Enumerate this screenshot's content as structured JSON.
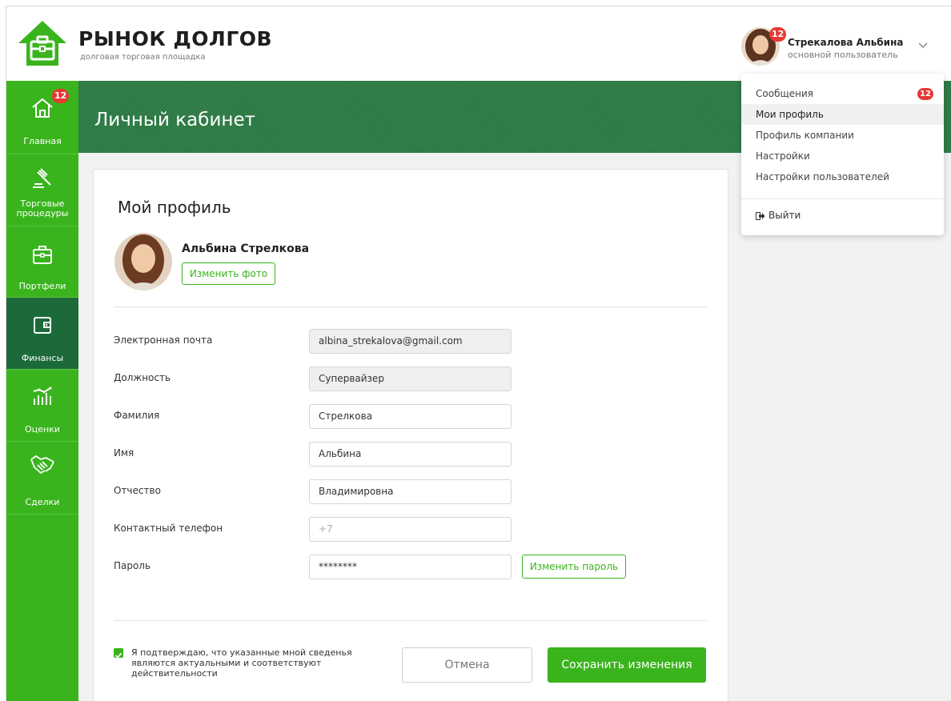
{
  "header": {
    "title": "РЫНОК ДОЛГОВ",
    "subtitle": "долговая торговая площадка",
    "user": {
      "name": "Стрекалова Альбина",
      "role": "основной пользователь",
      "badge": "12"
    }
  },
  "sidebar": {
    "items": [
      {
        "label": "Главная",
        "icon": "home-icon",
        "badge": "12"
      },
      {
        "label": "Торговые процедуры",
        "icon": "gavel-icon"
      },
      {
        "label": "Портфели",
        "icon": "briefcase-icon"
      },
      {
        "label": "Финансы",
        "icon": "wallet-icon",
        "active": true
      },
      {
        "label": "Оценки",
        "icon": "chart-icon"
      },
      {
        "label": "Сделки",
        "icon": "handshake-icon"
      }
    ]
  },
  "banner": {
    "title": "Личный кабинет"
  },
  "profile": {
    "title": "Мой профиль",
    "full_name": "Альбина Стрелкова",
    "change_photo": "Изменить фото",
    "fields": [
      {
        "label": "Электронная почта",
        "value": "albina_strekalova@gmail.com",
        "readonly": true
      },
      {
        "label": "Должность",
        "value": "Супервайзер",
        "readonly": true
      },
      {
        "label": "Фамилия",
        "value": "Стрелкова"
      },
      {
        "label": "Имя",
        "value": "Альбина"
      },
      {
        "label": "Отчество",
        "value": "Владимировна"
      },
      {
        "label": "Контактный телефон",
        "value": "",
        "placeholder": "+7"
      },
      {
        "label": "Пароль",
        "value": "********"
      }
    ],
    "change_password": "Изменить пароль",
    "confirm_text": "Я подтверждаю, что указанные мной сведенья являются актуальными и соответствуют действительности",
    "confirm_checked": true,
    "cancel": "Отмена",
    "save": "Сохранить изменения"
  },
  "dropdown": {
    "items": [
      {
        "label": "Сообщения",
        "badge": "12"
      },
      {
        "label": "Мои профиль",
        "hover": true
      },
      {
        "label": "Профиль компании"
      },
      {
        "label": "Настройки"
      },
      {
        "label": "Настройки пользователей"
      }
    ],
    "logout": "Выйти"
  },
  "colors": {
    "brand_green": "#3ab41d",
    "dark_green": "#1c6a39",
    "banner_green": "#2e7d46",
    "badge_red": "#e53935"
  }
}
